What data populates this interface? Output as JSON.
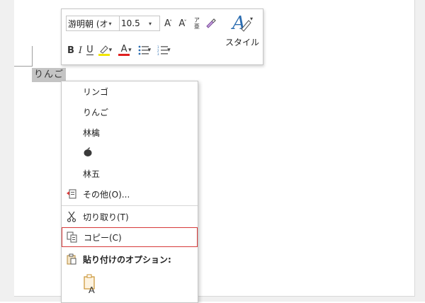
{
  "document": {
    "selected_text": "りんご"
  },
  "mini_toolbar": {
    "font_name": "游明朝 (オ",
    "font_size": "10.5",
    "grow_font": "A",
    "shrink_font": "A",
    "phonetic": "ア亜",
    "bold": "B",
    "italic": "I",
    "underline": "U",
    "font_color": "A",
    "styles_label": "スタイル",
    "highlight_color": "#f2e600",
    "font_color_value": "#e02020"
  },
  "context_menu": {
    "suggestions": [
      "リンゴ",
      "りんご",
      "林檎"
    ],
    "suggestion_4": "林五",
    "more": "その他(O)...",
    "cut": "切り取り(T)",
    "copy": "コピー(C)",
    "paste_options": "貼り付けのオプション:",
    "highlight_color": "#d63a3a"
  }
}
